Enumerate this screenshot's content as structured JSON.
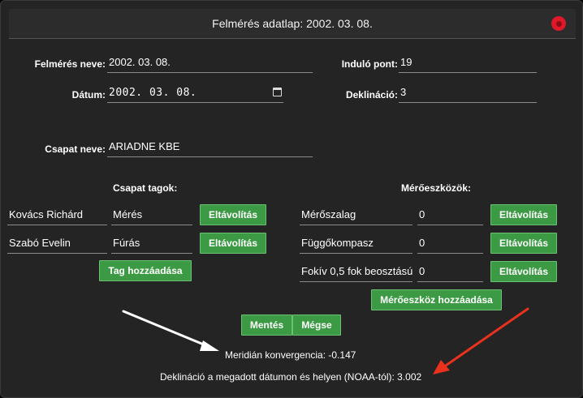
{
  "window": {
    "title": "Felmérés adatlap: 2002. 03. 08."
  },
  "form": {
    "survey_name_label": "Felmérés neve:",
    "survey_name_value": "2002. 03. 08.",
    "date_label": "Dátum:",
    "date_value": "2002. 03. 08.",
    "start_point_label": "Induló pont:",
    "start_point_value": "19",
    "declination_label": "Deklináció:",
    "declination_value": "3",
    "team_name_label": "Csapat neve:",
    "team_name_value": "ARIADNE KBE"
  },
  "team": {
    "title": "Csapat tagok:",
    "members": [
      {
        "name": "Kovács Richárd",
        "role": "Mérés",
        "remove_label": "Eltávolítás"
      },
      {
        "name": "Szabó Evelin",
        "role": "Fúrás",
        "remove_label": "Eltávolítás"
      }
    ],
    "add_label": "Tag hozzáadása"
  },
  "instruments": {
    "title": "Mérőeszközök:",
    "items": [
      {
        "name": "Mérőszalag",
        "value": "0",
        "remove_label": "Eltávolítás"
      },
      {
        "name": "Függőkompasz",
        "value": "0",
        "remove_label": "Eltávolítás"
      },
      {
        "name": "Fokív 0,5 fok beosztású",
        "value": "0",
        "remove_label": "Eltávolítás"
      }
    ],
    "add_label": "Mérőeszköz hozzáadása"
  },
  "actions": {
    "save_label": "Mentés",
    "cancel_label": "Mégse"
  },
  "results": {
    "meridian": "Meridián konvergencia: -0.147",
    "declination_noaa": "Deklináció a megadott dátumon és helyen (NOAA-tól): 3.002"
  },
  "colors": {
    "button_green": "#3d9a44",
    "close_red": "#e0192a",
    "arrow_white": "#ffffff",
    "arrow_red": "#e8321e"
  }
}
